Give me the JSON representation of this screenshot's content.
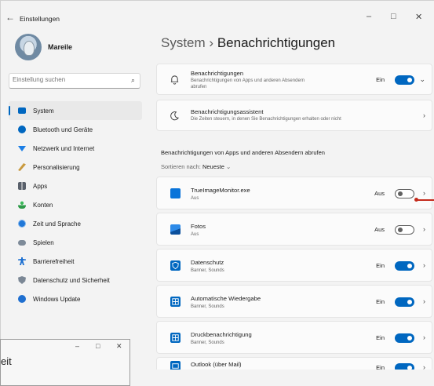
{
  "window": {
    "back_label": "←",
    "title": "Einstellungen",
    "minimize": "–",
    "maximize": "□",
    "close": "✕"
  },
  "user": {
    "name": "Mareile"
  },
  "search": {
    "placeholder": "Einstellung suchen",
    "icon": "search-icon"
  },
  "nav": [
    {
      "label": "System",
      "icon": "system-icon",
      "color": "#0067c0",
      "active": true
    },
    {
      "label": "Bluetooth und Geräte",
      "icon": "bluetooth-icon",
      "color": "#0067c0"
    },
    {
      "label": "Netzwerk und Internet",
      "icon": "wifi-icon",
      "color": "#1b7ee6"
    },
    {
      "label": "Personalisierung",
      "icon": "brush-icon",
      "color": "#c9a13b"
    },
    {
      "label": "Apps",
      "icon": "apps-icon",
      "color": "#59606b"
    },
    {
      "label": "Konten",
      "icon": "person-icon",
      "color": "#2e9a48"
    },
    {
      "label": "Zeit und Sprache",
      "icon": "globe-clock-icon",
      "color": "#2178d8"
    },
    {
      "label": "Spielen",
      "icon": "gamepad-icon",
      "color": "#7e8b99"
    },
    {
      "label": "Barrierefreiheit",
      "icon": "accessibility-icon",
      "color": "#1b6fd1"
    },
    {
      "label": "Datenschutz und Sicherheit",
      "icon": "shield-icon",
      "color": "#7b8795"
    },
    {
      "label": "Windows Update",
      "icon": "update-icon",
      "color": "#1f6fd0"
    }
  ],
  "header": {
    "crumb_parent": "System",
    "separator": "›",
    "crumb_current": "Benachrichtigungen"
  },
  "top_cards": [
    {
      "title": "Benachrichtigungen",
      "subtitle": "Benachrichtigungen von Apps und anderen Absendern abrufen",
      "state": "Ein",
      "toggle": true,
      "chevron": "⌄",
      "icon": "bell-icon"
    },
    {
      "title": "Benachrichtigungsassistent",
      "subtitle": "Die Zeiten steuern, in denen Sie Benachrichtigungen erhalten oder nicht",
      "chevron": "›",
      "icon": "moon-icon"
    }
  ],
  "section_title": "Benachrichtigungen von Apps und anderen Absendern abrufen",
  "sort": {
    "label": "Sortieren nach:",
    "value": "Neueste",
    "chevron": "⌄"
  },
  "apps": [
    {
      "name": "TrueImageMonitor.exe",
      "detail": "Aus",
      "state": "Aus",
      "on": false,
      "icon": "app-generic-icon",
      "color": "#0a74d9"
    },
    {
      "name": "Fotos",
      "detail": "Aus",
      "state": "Aus",
      "on": false,
      "icon": "photos-icon",
      "color": "#1a6fc7"
    },
    {
      "name": "Datenschutz",
      "detail": "Banner, Sounds",
      "state": "Ein",
      "on": true,
      "icon": "shield-app-icon",
      "color": "#0067c0"
    },
    {
      "name": "Automatische Wiedergabe",
      "detail": "Banner, Sounds",
      "state": "Ein",
      "on": true,
      "icon": "autoplay-icon",
      "color": "#0067c0"
    },
    {
      "name": "Druckbenachrichtigung",
      "detail": "Banner, Sounds",
      "state": "Ein",
      "on": true,
      "icon": "printer-icon",
      "color": "#0067c0"
    },
    {
      "name": "Outlook (über Mail)",
      "detail": "",
      "state": "Ein",
      "on": true,
      "icon": "outlook-icon",
      "color": "#0067c0"
    }
  ],
  "chevron_right": "›",
  "overlay_window": {
    "minimize": "–",
    "maximize": "□",
    "close": "✕",
    "text": "eit"
  }
}
